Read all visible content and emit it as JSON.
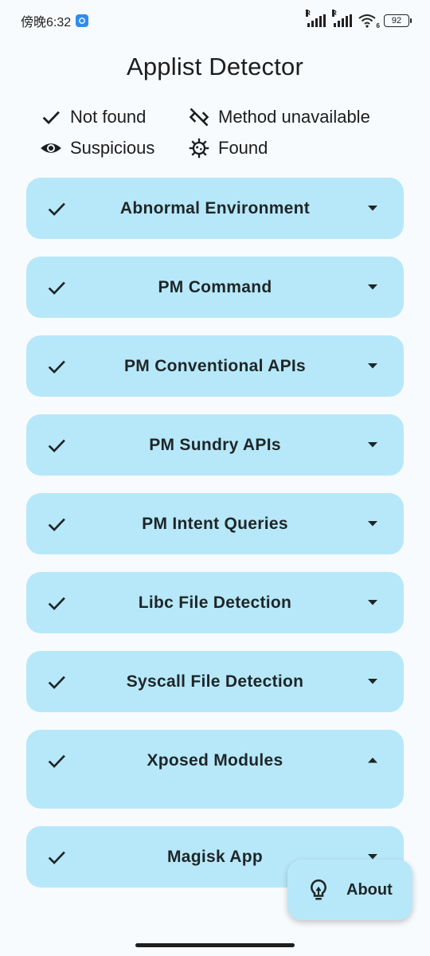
{
  "status_bar": {
    "time": "傍晚6:32",
    "signal_1_tag": "R",
    "signal_2_tag": "R",
    "wifi_tag": "6",
    "battery": "92"
  },
  "app": {
    "title": "Applist Detector"
  },
  "legend": {
    "not_found": "Not found",
    "method_unavailable": "Method unavailable",
    "suspicious": "Suspicious",
    "found": "Found"
  },
  "checks": [
    {
      "label": "Abnormal Environment",
      "status_icon": "check-icon",
      "expanded": false
    },
    {
      "label": "PM Command",
      "status_icon": "check-icon",
      "expanded": false
    },
    {
      "label": "PM Conventional APIs",
      "status_icon": "check-icon",
      "expanded": false
    },
    {
      "label": "PM Sundry APIs",
      "status_icon": "check-icon",
      "expanded": false
    },
    {
      "label": "PM Intent Queries",
      "status_icon": "check-icon",
      "expanded": false
    },
    {
      "label": "Libc File Detection",
      "status_icon": "check-icon",
      "expanded": false
    },
    {
      "label": "Syscall File Detection",
      "status_icon": "check-icon",
      "expanded": false
    },
    {
      "label": "Xposed Modules",
      "status_icon": "check-icon",
      "expanded": true
    },
    {
      "label": "Magisk App",
      "status_icon": "check-icon",
      "expanded": false
    }
  ],
  "fab": {
    "label": "About",
    "icon": "lightbulb-icon"
  },
  "colors": {
    "card_bg": "#b7e8f9",
    "page_bg": "#f8fbfd",
    "text": "#1b1d1f"
  }
}
